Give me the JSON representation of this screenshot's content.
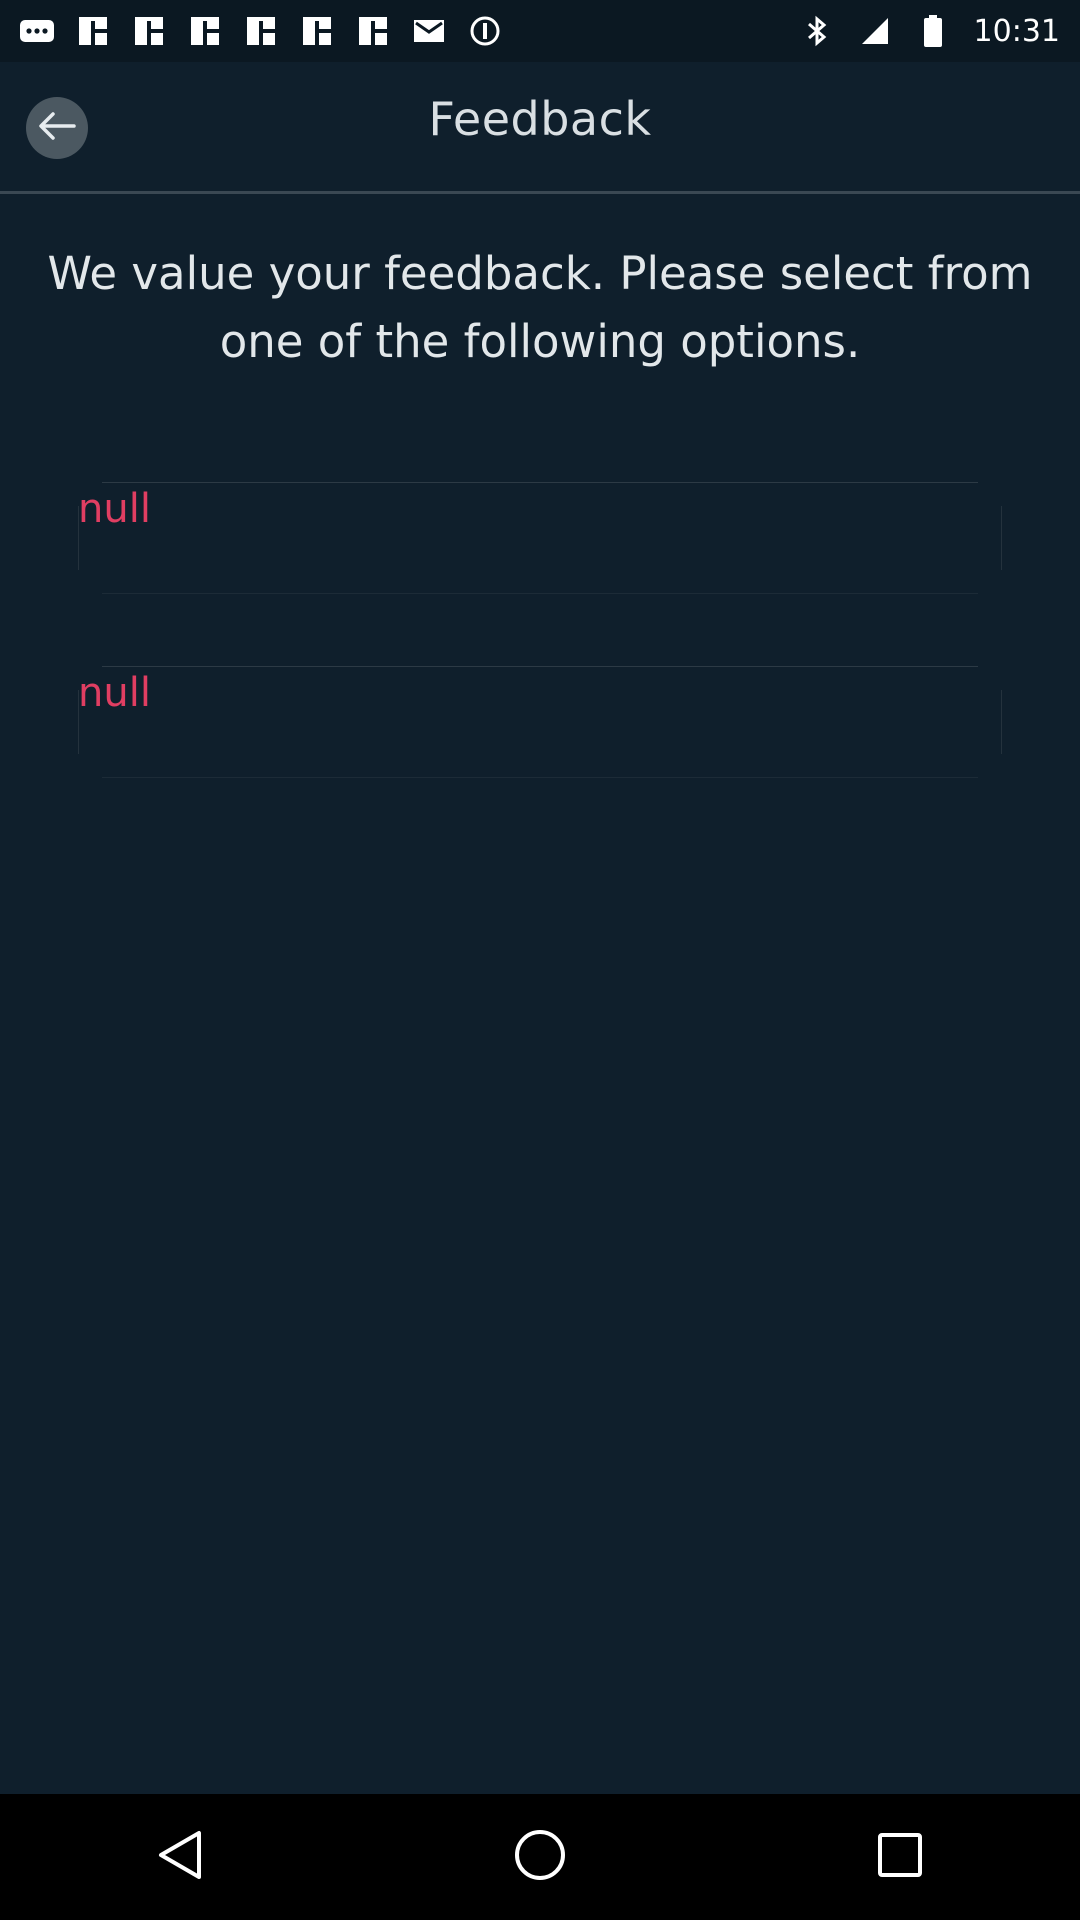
{
  "status_bar": {
    "time": "10:31",
    "icons_left": [
      "more-icon",
      "grid-icon",
      "grid-icon",
      "grid-icon",
      "grid-icon",
      "grid-icon",
      "grid-icon",
      "mail-icon",
      "info-icon"
    ],
    "icons_right": [
      "bluetooth-icon",
      "signal-icon",
      "battery-icon"
    ]
  },
  "header": {
    "title": "Feedback",
    "back_icon": "arrow-left-icon"
  },
  "main": {
    "intro_text": "We value your feedback. Please select from one of the following options.",
    "options": [
      {
        "label": "null"
      },
      {
        "label": "null"
      }
    ]
  },
  "colors": {
    "background": "#0f1f2c",
    "accent": "#e03e62",
    "nav_bar": "#000000"
  },
  "nav_bar": {
    "buttons": [
      "back-triangle-icon",
      "home-circle-icon",
      "recents-square-icon"
    ]
  }
}
